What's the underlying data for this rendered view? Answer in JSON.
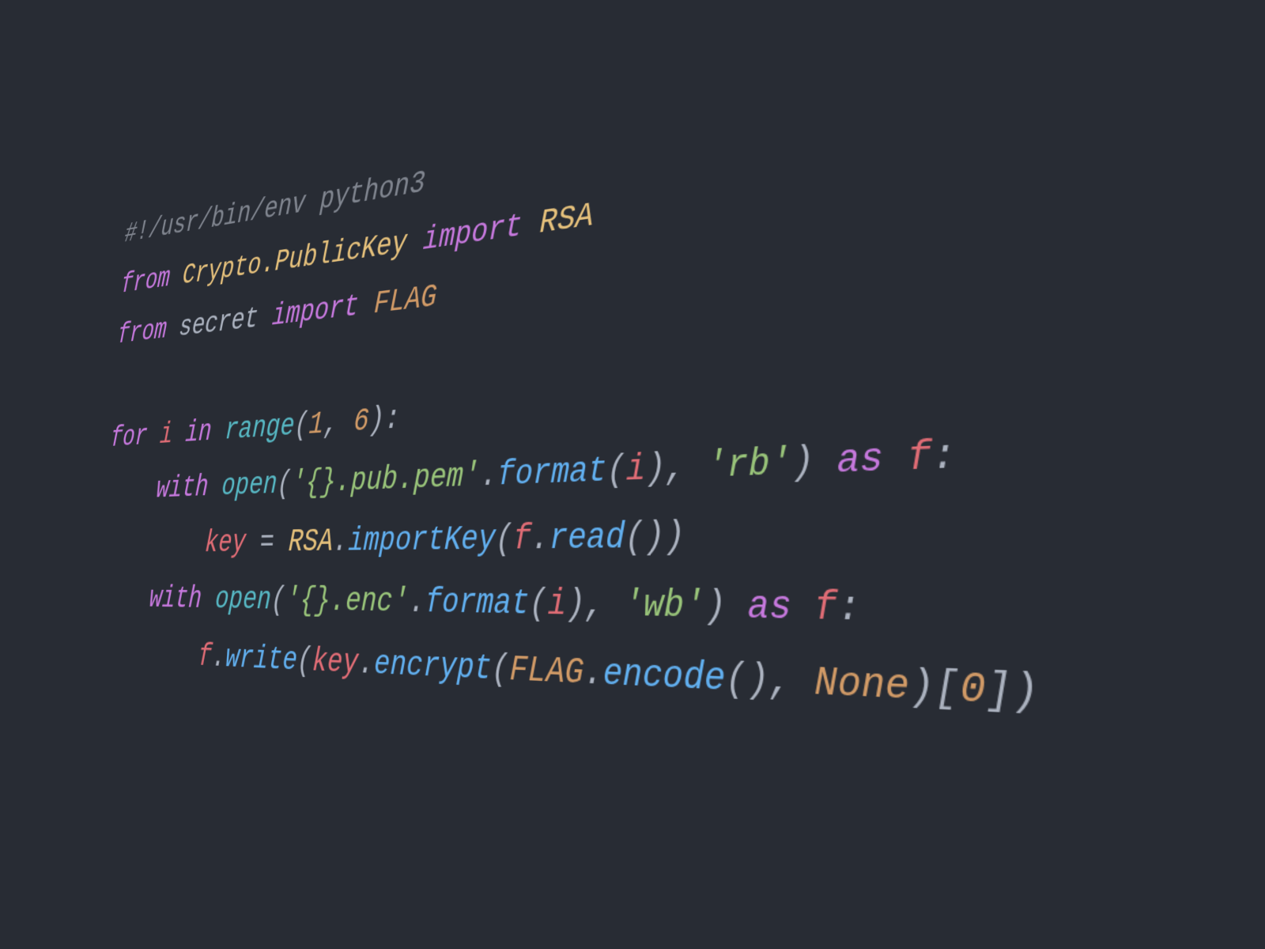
{
  "code": {
    "lines": [
      {
        "indent": 0,
        "tokens": [
          {
            "cls": "comment",
            "text": "#!/usr/bin/env python3"
          }
        ]
      },
      {
        "indent": 0,
        "tokens": [
          {
            "cls": "keyword",
            "text": "from"
          },
          {
            "cls": "plain",
            "text": " "
          },
          {
            "cls": "module",
            "text": "Crypto.PublicKey"
          },
          {
            "cls": "plain",
            "text": " "
          },
          {
            "cls": "keyword",
            "text": "import"
          },
          {
            "cls": "plain",
            "text": " "
          },
          {
            "cls": "class",
            "text": "RSA"
          }
        ]
      },
      {
        "indent": 0,
        "tokens": [
          {
            "cls": "keyword",
            "text": "from"
          },
          {
            "cls": "plain",
            "text": " "
          },
          {
            "cls": "module2",
            "text": "secret"
          },
          {
            "cls": "plain",
            "text": " "
          },
          {
            "cls": "keyword",
            "text": "import"
          },
          {
            "cls": "plain",
            "text": " "
          },
          {
            "cls": "const",
            "text": "FLAG"
          }
        ]
      },
      {
        "indent": 0,
        "blank": true,
        "tokens": []
      },
      {
        "indent": 0,
        "tokens": [
          {
            "cls": "keyword",
            "text": "for"
          },
          {
            "cls": "plain",
            "text": " "
          },
          {
            "cls": "ident",
            "text": "i"
          },
          {
            "cls": "plain",
            "text": " "
          },
          {
            "cls": "keyword",
            "text": "in"
          },
          {
            "cls": "plain",
            "text": " "
          },
          {
            "cls": "builtin",
            "text": "range"
          },
          {
            "cls": "punct",
            "text": "("
          },
          {
            "cls": "number",
            "text": "1"
          },
          {
            "cls": "punct",
            "text": ", "
          },
          {
            "cls": "number",
            "text": "6"
          },
          {
            "cls": "punct",
            "text": "):"
          }
        ]
      },
      {
        "indent": 1,
        "tokens": [
          {
            "cls": "keyword",
            "text": "with"
          },
          {
            "cls": "plain",
            "text": " "
          },
          {
            "cls": "builtin",
            "text": "open"
          },
          {
            "cls": "punct",
            "text": "("
          },
          {
            "cls": "string",
            "text": "'{}.pub.pem'"
          },
          {
            "cls": "punct",
            "text": "."
          },
          {
            "cls": "func",
            "text": "format"
          },
          {
            "cls": "punct",
            "text": "("
          },
          {
            "cls": "ident",
            "text": "i"
          },
          {
            "cls": "punct",
            "text": "), "
          },
          {
            "cls": "string",
            "text": "'rb'"
          },
          {
            "cls": "punct",
            "text": ") "
          },
          {
            "cls": "keyword",
            "text": "as"
          },
          {
            "cls": "plain",
            "text": " "
          },
          {
            "cls": "ident",
            "text": "f"
          },
          {
            "cls": "punct",
            "text": ":"
          }
        ]
      },
      {
        "indent": 2,
        "tokens": [
          {
            "cls": "ident",
            "text": "key"
          },
          {
            "cls": "plain",
            "text": " "
          },
          {
            "cls": "punct",
            "text": "= "
          },
          {
            "cls": "class",
            "text": "RSA"
          },
          {
            "cls": "punct",
            "text": "."
          },
          {
            "cls": "func",
            "text": "importKey"
          },
          {
            "cls": "punct",
            "text": "("
          },
          {
            "cls": "ident",
            "text": "f"
          },
          {
            "cls": "punct",
            "text": "."
          },
          {
            "cls": "func",
            "text": "read"
          },
          {
            "cls": "punct",
            "text": "())"
          }
        ]
      },
      {
        "indent": 1,
        "tokens": [
          {
            "cls": "keyword",
            "text": "with"
          },
          {
            "cls": "plain",
            "text": " "
          },
          {
            "cls": "builtin",
            "text": "open"
          },
          {
            "cls": "punct",
            "text": "("
          },
          {
            "cls": "string",
            "text": "'{}.enc'"
          },
          {
            "cls": "punct",
            "text": "."
          },
          {
            "cls": "func",
            "text": "format"
          },
          {
            "cls": "punct",
            "text": "("
          },
          {
            "cls": "ident",
            "text": "i"
          },
          {
            "cls": "punct",
            "text": "), "
          },
          {
            "cls": "string",
            "text": "'wb'"
          },
          {
            "cls": "punct",
            "text": ") "
          },
          {
            "cls": "keyword",
            "text": "as"
          },
          {
            "cls": "plain",
            "text": " "
          },
          {
            "cls": "ident",
            "text": "f"
          },
          {
            "cls": "punct",
            "text": ":"
          }
        ]
      },
      {
        "indent": 2,
        "tokens": [
          {
            "cls": "ident",
            "text": "f"
          },
          {
            "cls": "punct",
            "text": "."
          },
          {
            "cls": "func",
            "text": "write"
          },
          {
            "cls": "punct",
            "text": "("
          },
          {
            "cls": "ident",
            "text": "key"
          },
          {
            "cls": "punct",
            "text": "."
          },
          {
            "cls": "func",
            "text": "encrypt"
          },
          {
            "cls": "punct",
            "text": "("
          },
          {
            "cls": "const",
            "text": "FLAG"
          },
          {
            "cls": "punct",
            "text": "."
          },
          {
            "cls": "func",
            "text": "encode"
          },
          {
            "cls": "punct",
            "text": "(), "
          },
          {
            "cls": "const",
            "text": "None"
          },
          {
            "cls": "punct",
            "text": ")["
          },
          {
            "cls": "number",
            "text": "0"
          },
          {
            "cls": "punct",
            "text": "])"
          }
        ]
      }
    ]
  }
}
